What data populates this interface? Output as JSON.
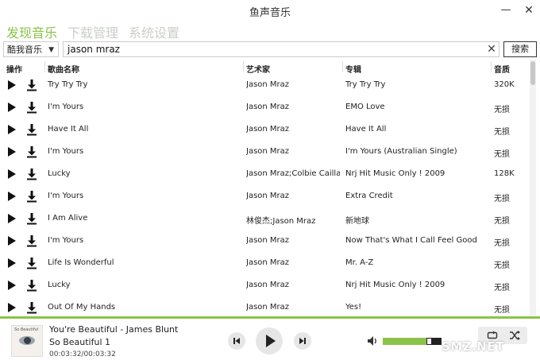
{
  "window": {
    "title": "鱼声音乐",
    "minimize": "—",
    "close": "✕"
  },
  "nav": {
    "tabs": [
      "发现音乐",
      "下载管理",
      "系统设置"
    ]
  },
  "search": {
    "source": "酷我音乐",
    "query": "jason mraz",
    "clear": "✕",
    "button": "搜索"
  },
  "table": {
    "headers": {
      "ops": "操作",
      "name": "歌曲名称",
      "artist": "艺术家",
      "album": "专辑",
      "quality": "音质"
    },
    "rows": [
      {
        "name": "Try Try Try",
        "artist": "Jason Mraz",
        "album": "Try Try Try",
        "quality": "320K"
      },
      {
        "name": "I'm Yours",
        "artist": "Jason Mraz",
        "album": "EMO Love",
        "quality": "无损"
      },
      {
        "name": "Have It All",
        "artist": "Jason Mraz",
        "album": "Have It All",
        "quality": "无损"
      },
      {
        "name": "I'm Yours",
        "artist": "Jason Mraz",
        "album": "I'm Yours (Australian Single)",
        "quality": "无损"
      },
      {
        "name": "Lucky",
        "artist": "Jason Mraz;Colbie Caillat",
        "album": "Nrj Hit Music Only ! 2009",
        "quality": "128K"
      },
      {
        "name": "I'm Yours",
        "artist": "Jason Mraz",
        "album": "Extra Credit",
        "quality": "无损"
      },
      {
        "name": "I Am Alive",
        "artist": "林俊杰;Jason Mraz",
        "album": "新地球",
        "quality": "无损"
      },
      {
        "name": "I'm Yours",
        "artist": "Jason Mraz",
        "album": "Now That's What I Call Feel Good",
        "quality": "无损"
      },
      {
        "name": "Life Is Wonderful",
        "artist": "Jason Mraz",
        "album": "Mr. A-Z",
        "quality": "无损"
      },
      {
        "name": "Lucky",
        "artist": "Jason Mraz",
        "album": "Nrj Hit Music Only ! 2009",
        "quality": "无损"
      },
      {
        "name": "Out Of My Hands",
        "artist": "Jason Mraz",
        "album": "Yes!",
        "quality": "无损"
      }
    ]
  },
  "player": {
    "title": "You're Beautiful - James Blunt",
    "album": "So Beautiful 1",
    "time": "00:03:32/00:03:32",
    "cover_text": "So Beautiful",
    "volume": 0.82
  },
  "watermark": "SMZ.NET",
  "colors": {
    "accent": "#8bc34a",
    "nav_inactive": "#c9cfc6"
  }
}
